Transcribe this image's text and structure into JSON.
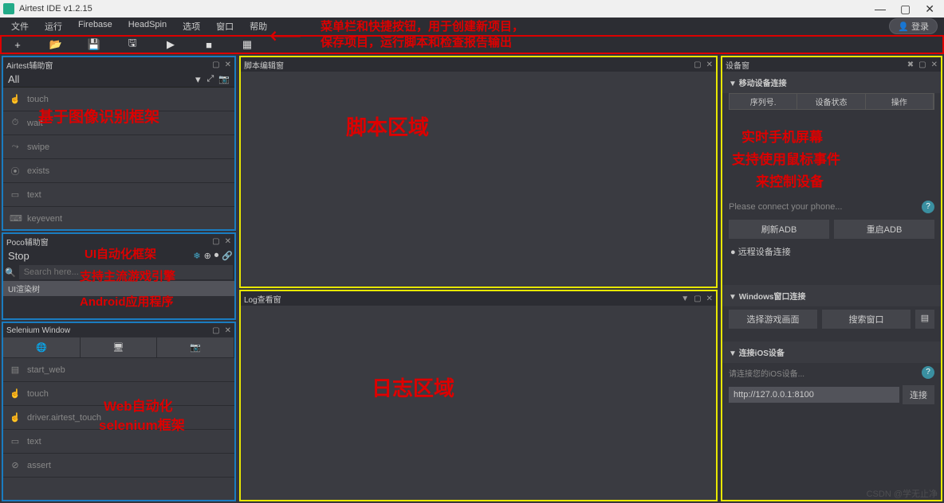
{
  "window": {
    "title": "Airtest IDE v1.2.15"
  },
  "menu": [
    "文件",
    "运行",
    "Firebase",
    "HeadSpin",
    "选项",
    "窗口",
    "帮助"
  ],
  "login": "登录",
  "toolbar_icons": [
    "plus",
    "folder",
    "save",
    "saveas",
    "play",
    "stop",
    "grid"
  ],
  "panels": {
    "airtest": {
      "title": "Airtest辅助窗",
      "dropdown": "All",
      "items": [
        {
          "icon": "👆",
          "label": "touch"
        },
        {
          "icon": "⏱",
          "label": "wait"
        },
        {
          "icon": "↔",
          "label": "swipe"
        },
        {
          "icon": "🔍",
          "label": "exists"
        },
        {
          "icon": "▭",
          "label": "text"
        },
        {
          "icon": "⌨",
          "label": "keyevent"
        }
      ]
    },
    "poco": {
      "title": "Poco辅助窗",
      "mode": "Stop",
      "search_ph": "Search here...",
      "tree": "UI渲染树"
    },
    "selenium": {
      "title": "Selenium Window",
      "btns": [
        "🌐",
        "🖥",
        "📷"
      ],
      "items": [
        {
          "icon": "▤",
          "label": "start_web"
        },
        {
          "icon": "👆",
          "label": "touch"
        },
        {
          "icon": "👆",
          "label": "driver.airtest_touch"
        },
        {
          "icon": "▭",
          "label": "text"
        },
        {
          "icon": "⊘",
          "label": "assert"
        }
      ]
    },
    "script": {
      "title": "脚本编辑窗"
    },
    "log": {
      "title": "Log查看窗"
    },
    "device": {
      "title": "设备窗",
      "mobile_hdr": "移动设备连接",
      "cols": [
        "序列号.",
        "设备状态",
        "操作"
      ],
      "connect_msg": "Please connect your phone...",
      "refresh": "刷新ADB",
      "restart": "重启ADB",
      "remote": "远程设备连接",
      "win_hdr": "Windows窗口连接",
      "select_game": "选择游戏画面",
      "search_win": "搜索窗口",
      "ios_hdr": "连接iOS设备",
      "ios_msg": "请连接您的iOS设备...",
      "ip": "http://127.0.0.1:8100",
      "connect_btn": "连接"
    }
  },
  "annotations": {
    "menu1": "菜单栏和快捷按钮，用于创建新项目，",
    "menu2": "保存项目，运行脚本和检查报告输出",
    "airtest": "基于图像识别框架",
    "poco1": "UI自动化框架",
    "poco2": "支持主流游戏引擎",
    "poco3": "Android应用程序",
    "sel1": "Web自动化",
    "sel2": "selenium框架",
    "script": "脚本区域",
    "log": "日志区域",
    "dev1": "实时手机屏幕",
    "dev2": "支持使用鼠标事件",
    "dev3": "来控制设备"
  },
  "watermark": "CSDN @学无止净"
}
